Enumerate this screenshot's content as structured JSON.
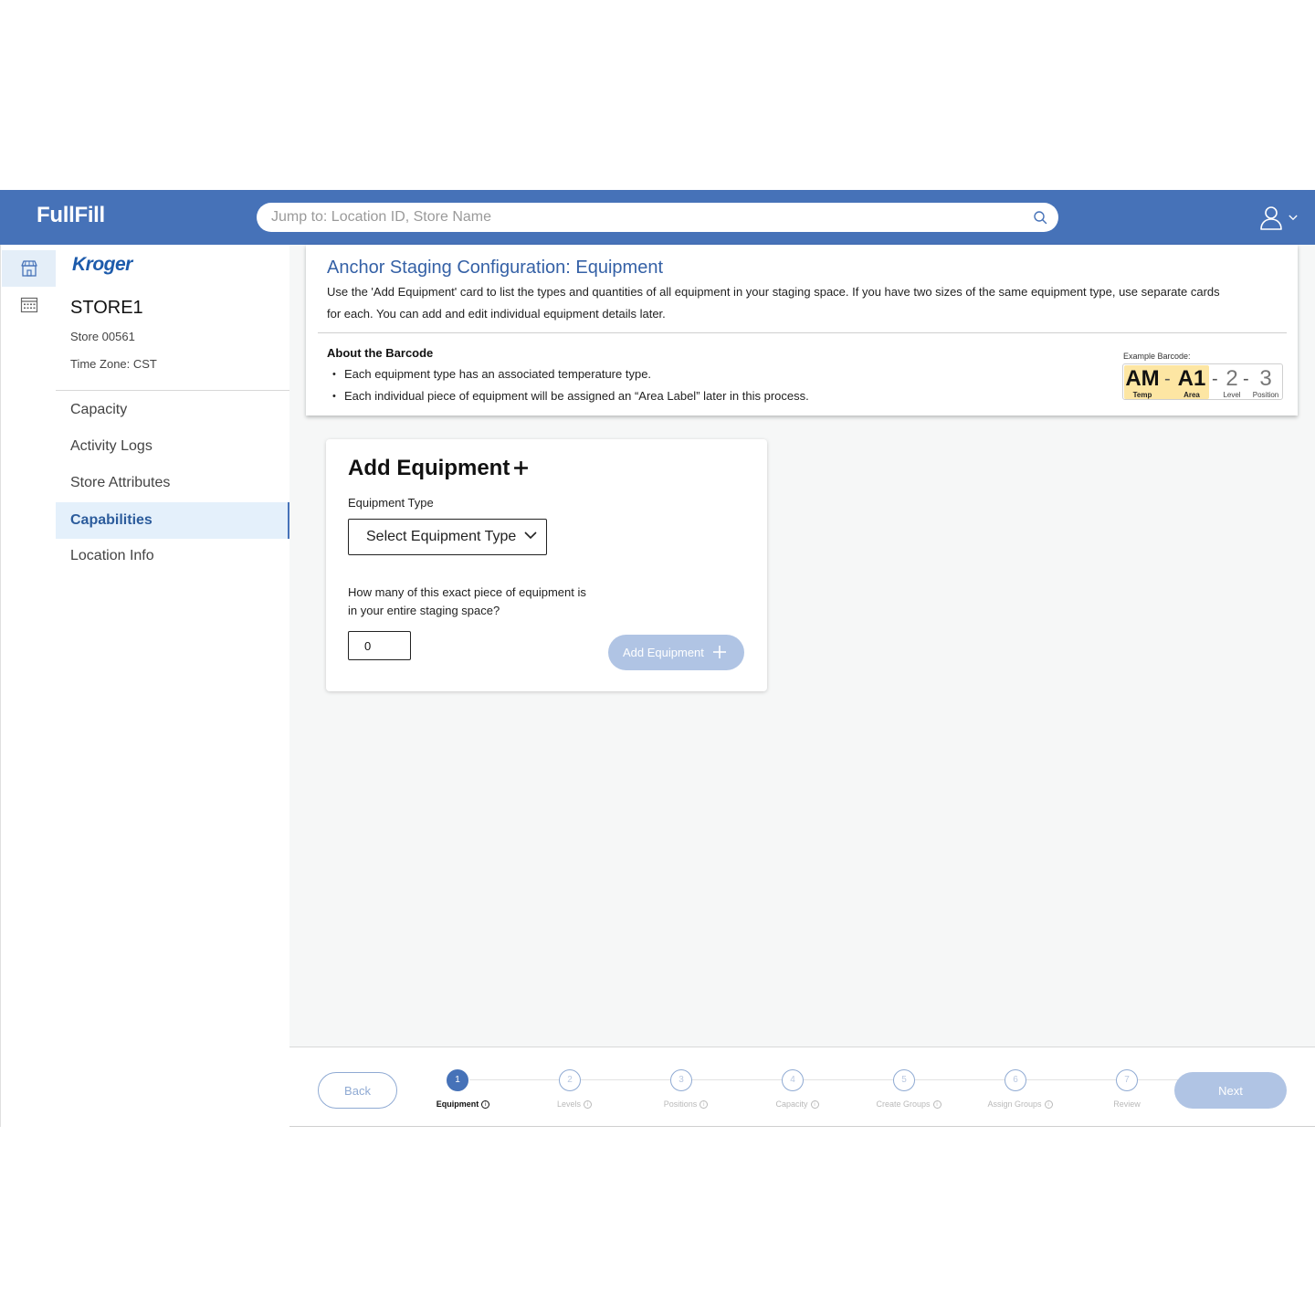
{
  "app": {
    "brand": "FullFill"
  },
  "search": {
    "placeholder": "Jump to: Location ID, Store Name"
  },
  "rail": {
    "items": [
      {
        "icon": "store-icon",
        "active": true
      },
      {
        "icon": "calendar-grid-icon",
        "active": false
      }
    ]
  },
  "sidebar": {
    "logo": "Kroger",
    "store_name": "STORE1",
    "store_number": "Store 00561",
    "time_zone": "Time Zone: CST",
    "nav": [
      {
        "label": "Capacity"
      },
      {
        "label": "Activity Logs"
      },
      {
        "label": "Store Attributes"
      },
      {
        "label": "Capabilities",
        "active": true
      },
      {
        "label": "Location Info"
      }
    ]
  },
  "info": {
    "title": "Anchor Staging Configuration: Equipment",
    "description": "Use the 'Add Equipment' card to list the types and quantities of all equipment in your staging space. If you have two sizes of the same equipment type, use separate cards for each. You can add and edit individual equipment details later.",
    "about_title": "About the Barcode",
    "bullets": [
      "Each equipment type has an associated temperature type.",
      "Each individual piece of equipment will be assigned an “Area Label” later in this process."
    ],
    "barcode": {
      "label": "Example Barcode:",
      "temp": "AM",
      "temp_label": "Temp",
      "area": "A1",
      "area_label": "Area",
      "level": "2",
      "level_label": "Level",
      "position": "3",
      "position_label": "Position",
      "separator": "-",
      "highlight_color": "#fde6a3"
    }
  },
  "add_card": {
    "title": "Add Equipment",
    "title_icon": "plus-icon",
    "equipment_type_label": "Equipment Type",
    "select_value": "Select Equipment Type",
    "quantity_question": "How many of this exact piece of equipment is in your entire staging space?",
    "quantity_value": "0",
    "add_button": "Add Equipment"
  },
  "stepper": {
    "back": "Back",
    "next": "Next",
    "current_step": 1,
    "steps": [
      {
        "num": "1",
        "label": "Equipment",
        "info": true
      },
      {
        "num": "2",
        "label": "Levels",
        "info": true
      },
      {
        "num": "3",
        "label": "Positions",
        "info": true
      },
      {
        "num": "4",
        "label": "Capacity",
        "info": true
      },
      {
        "num": "5",
        "label": "Create Groups",
        "info": true
      },
      {
        "num": "6",
        "label": "Assign Groups",
        "info": true
      },
      {
        "num": "7",
        "label": "Review",
        "info": false
      }
    ]
  },
  "colors": {
    "header": "#4672b8",
    "accent": "#3561a6",
    "disabled_button": "#b0c4e4",
    "active_nav_bg": "#e4f0fb"
  }
}
